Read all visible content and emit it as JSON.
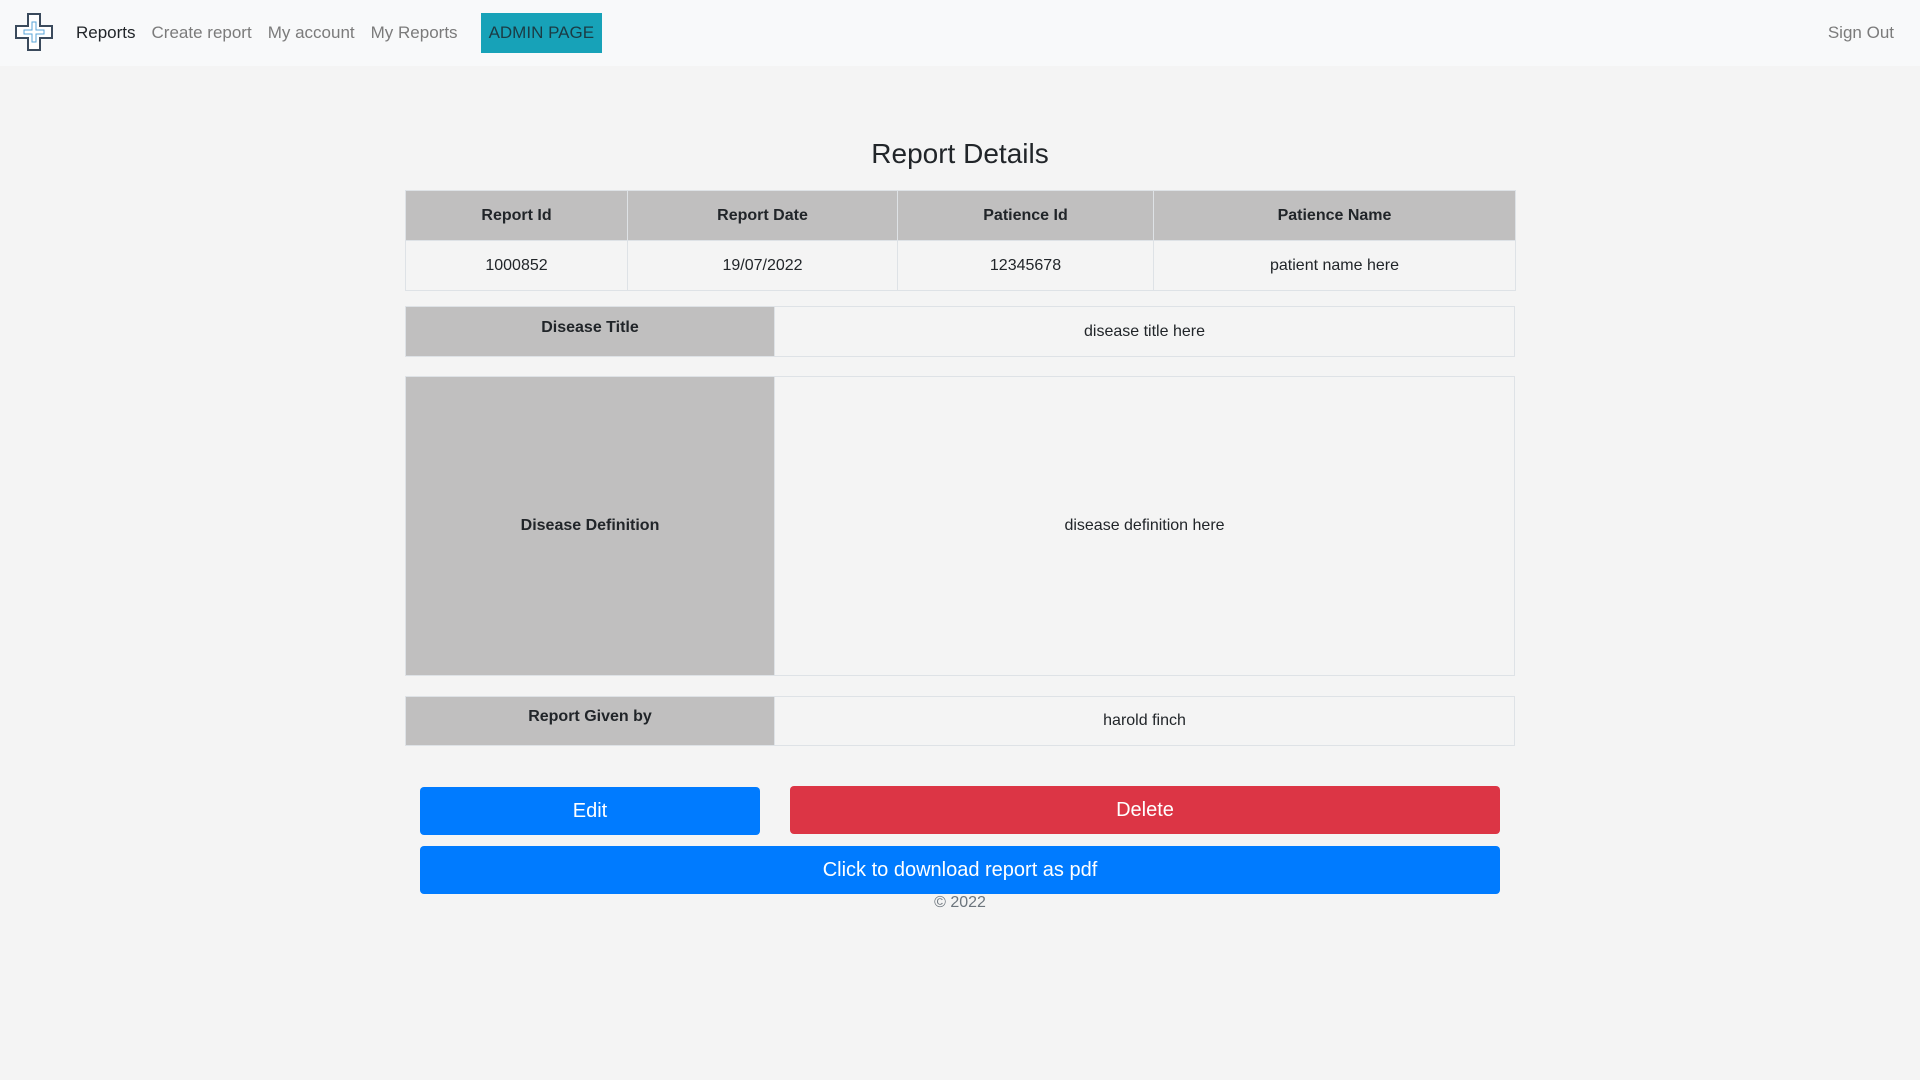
{
  "navbar": {
    "brand_icon": "medical-cross-icon",
    "links": [
      {
        "label": "Reports",
        "active": true
      },
      {
        "label": "Create report",
        "active": false
      },
      {
        "label": "My account",
        "active": false
      },
      {
        "label": "My Reports",
        "active": false
      }
    ],
    "admin_label": "ADMIN PAGE",
    "signout_label": "Sign Out"
  },
  "page": {
    "title": "Report Details"
  },
  "report": {
    "headers": [
      "Report Id",
      "Report Date",
      "Patience Id",
      "Patience Name"
    ],
    "values": [
      "1000852",
      "19/07/2022",
      "12345678",
      "patient name here"
    ],
    "disease_title_label": "Disease Title",
    "disease_title": "disease title here",
    "disease_definition_label": "Disease Definition",
    "disease_definition": "disease definition here",
    "given_by_label": "Report Given by",
    "given_by": "harold finch"
  },
  "actions": {
    "edit_label": "Edit",
    "delete_label": "Delete",
    "download_label": "Click to download report as pdf"
  },
  "footer": {
    "text": "© 2022"
  },
  "colors": {
    "primary": "#007bff",
    "danger": "#dc3545",
    "info": "#17a2b8",
    "header_cell": "#c0bfbf",
    "background": "#f4f4f4"
  }
}
